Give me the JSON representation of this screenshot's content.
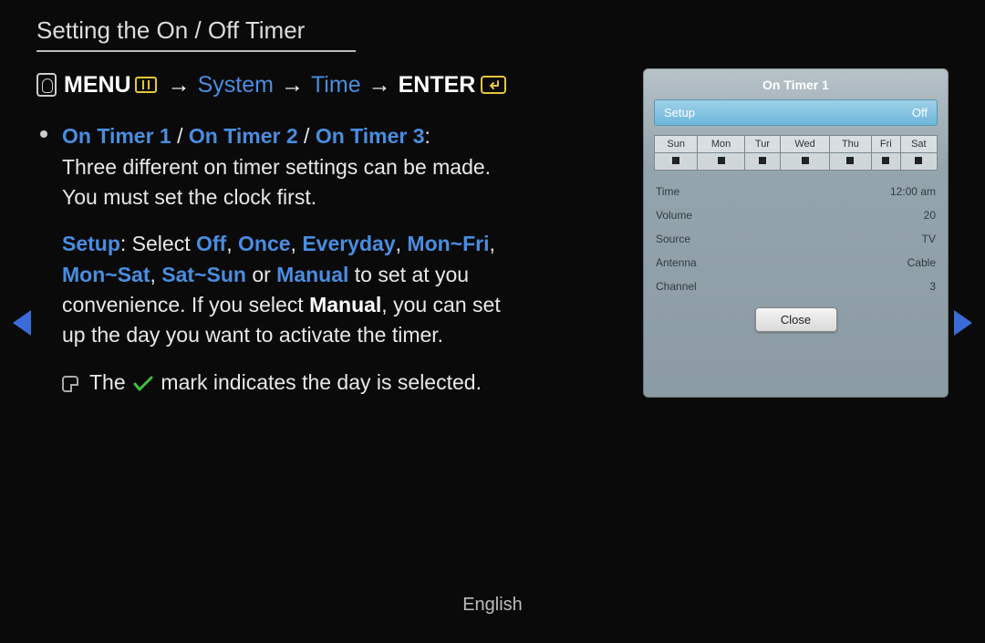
{
  "title": "Setting the On / Off Timer",
  "path": {
    "menu": "MENU",
    "system": "System",
    "time": "Time",
    "enter": "ENTER"
  },
  "bullets": {
    "timers": {
      "t1": "On Timer 1",
      "t2": "On Timer 2",
      "t3": "On Timer 3"
    },
    "timers_desc": "Three different on timer settings can be made. You must set the clock first.",
    "setup_label": "Setup",
    "select_word": "Select",
    "opts": {
      "off": "Off",
      "once": "Once",
      "everyday": "Everyday",
      "monfri": "Mon~Fri",
      "monsat": "Mon~Sat",
      "satsun": "Sat~Sun",
      "manual": "Manual"
    },
    "or_word": "or",
    "to_word": "to",
    "setup_desc1": "set at you convenience. If you select",
    "setup_desc2": "you can set up the day you want to activate the timer.",
    "note_pre": "The",
    "note_post": "mark indicates the day is selected."
  },
  "panel": {
    "title": "On Timer 1",
    "setup_label": "Setup",
    "setup_value": "Off",
    "days": [
      "Sun",
      "Mon",
      "Tur",
      "Wed",
      "Thu",
      "Fri",
      "Sat"
    ],
    "rows": [
      {
        "label": "Time",
        "value": "12:00 am"
      },
      {
        "label": "Volume",
        "value": "20"
      },
      {
        "label": "Source",
        "value": "TV"
      },
      {
        "label": "Antenna",
        "value": "Cable"
      },
      {
        "label": "Channel",
        "value": "3"
      }
    ],
    "close": "Close"
  },
  "footer": "English"
}
